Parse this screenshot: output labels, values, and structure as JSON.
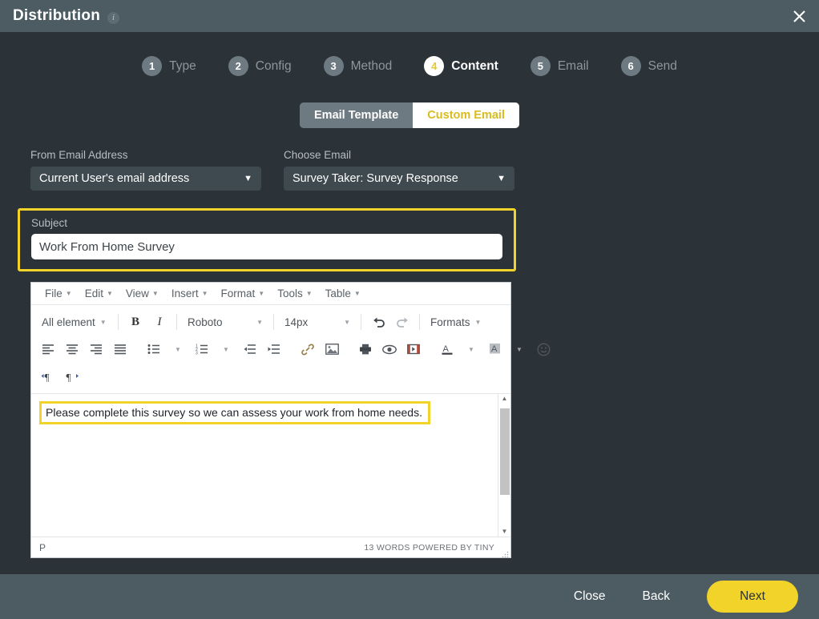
{
  "header": {
    "title": "Distribution",
    "info_icon": "info-icon",
    "close_icon": "close-icon"
  },
  "stepper": {
    "active_index": 3,
    "steps": [
      {
        "number": "1",
        "label": "Type"
      },
      {
        "number": "2",
        "label": "Config"
      },
      {
        "number": "3",
        "label": "Method"
      },
      {
        "number": "4",
        "label": "Content"
      },
      {
        "number": "5",
        "label": "Email"
      },
      {
        "number": "6",
        "label": "Send"
      }
    ]
  },
  "segmented": {
    "options": [
      {
        "label": "Email Template",
        "active": false
      },
      {
        "label": "Custom Email",
        "active": true
      }
    ]
  },
  "form": {
    "from_email": {
      "label": "From Email Address",
      "value": "Current User's email address",
      "chevron": "chevron-down-icon"
    },
    "choose_email": {
      "label": "Choose Email",
      "value": "Survey Taker: Survey Response",
      "chevron": "chevron-down-icon"
    }
  },
  "subject": {
    "label": "Subject",
    "value": "Work From Home Survey",
    "placeholder": "Subject",
    "highlighted": true
  },
  "editor": {
    "menubar": [
      "File",
      "Edit",
      "View",
      "Insert",
      "Format",
      "Tools",
      "Table"
    ],
    "toolbar_row1": {
      "element_select": "All element",
      "bold": "B",
      "italic": "I",
      "font_family": "Roboto",
      "font_size": "14px",
      "undo_icon": "undo-icon",
      "redo_icon": "redo-icon",
      "formats": "Formats"
    },
    "toolbar_row2": [
      "align-left-icon",
      "align-center-icon",
      "align-right-icon",
      "align-justify-icon",
      "bullet-list-icon",
      "numbered-list-icon",
      "outdent-icon",
      "indent-icon",
      "link-icon",
      "image-icon",
      "print-icon",
      "preview-icon",
      "media-icon",
      "text-color-icon",
      "background-color-icon",
      "emoji-icon"
    ],
    "toolbar_row3": [
      "ltr-icon",
      "rtl-icon"
    ],
    "content": "Please complete this survey so we can assess your work from home needs.",
    "content_highlighted": true,
    "status_path": "P",
    "status_info": "13 WORDS POWERED BY TINY"
  },
  "footer": {
    "close_label": "Close",
    "back_label": "Back",
    "next_label": "Next"
  },
  "colors": {
    "header_bar": "#4d5b63",
    "body_bg": "#2b3238",
    "accent_yellow": "#f2d329",
    "field_bg": "#3e4950",
    "muted_text": "#8d979d"
  }
}
